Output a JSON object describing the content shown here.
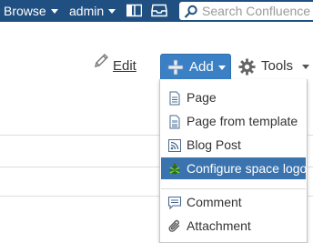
{
  "topbar": {
    "browse_label": "Browse",
    "admin_label": "admin",
    "search_placeholder": "Search Confluence",
    "background_color": "#205081"
  },
  "toolbar": {
    "edit_label": "Edit",
    "add_label": "Add",
    "tools_label": "Tools",
    "add_color": "#3b7fc4"
  },
  "add_menu": {
    "items": [
      {
        "label": "Page",
        "icon": "page-icon"
      },
      {
        "label": "Page from template",
        "icon": "template-icon"
      },
      {
        "label": "Blog Post",
        "icon": "blog-icon"
      },
      {
        "label": "Configure space logo",
        "icon": "space-logo-icon",
        "selected": true
      },
      {
        "label": "Comment",
        "icon": "comment-icon"
      },
      {
        "label": "Attachment",
        "icon": "paperclip-icon"
      }
    ],
    "selected_color": "#3b73af"
  }
}
